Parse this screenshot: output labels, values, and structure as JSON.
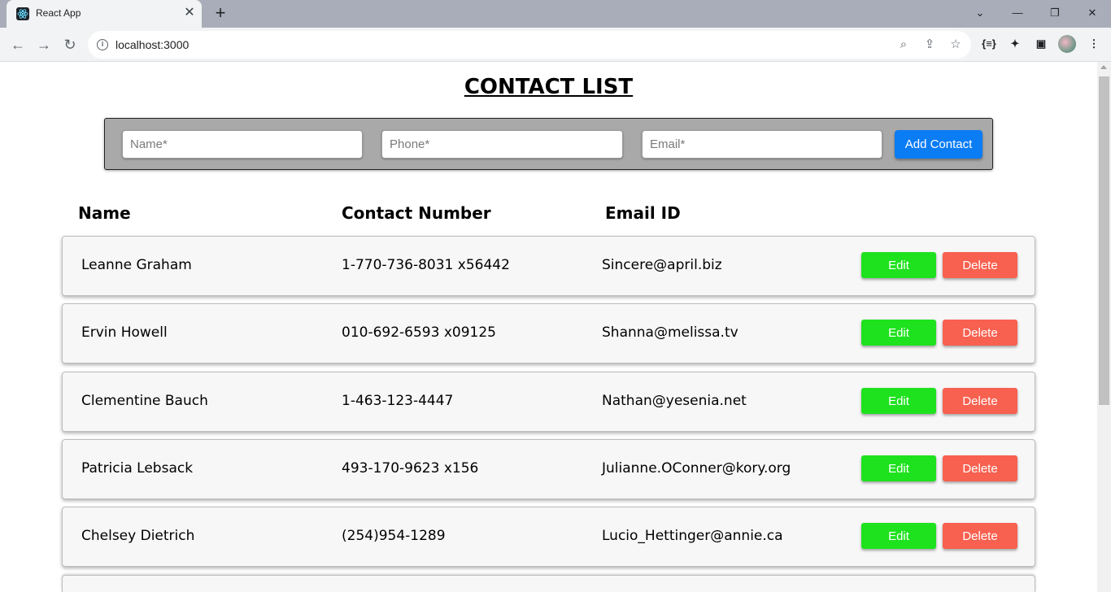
{
  "browser": {
    "tab_title": "React App",
    "tab_close": "✕",
    "new_tab": "+",
    "url": "localhost:3000",
    "window_controls": [
      "⌄",
      "—",
      "❐",
      "✕"
    ]
  },
  "page": {
    "title": "CONTACT LIST"
  },
  "form": {
    "name_placeholder": "Name*",
    "phone_placeholder": "Phone*",
    "email_placeholder": "Email*",
    "add_label": "Add Contact"
  },
  "columns": {
    "name": "Name",
    "phone": "Contact Number",
    "email": "Email ID"
  },
  "contacts": [
    {
      "name": "Leanne Graham",
      "phone": "1-770-736-8031 x56442",
      "email": "Sincere@april.biz"
    },
    {
      "name": "Ervin Howell",
      "phone": "010-692-6593 x09125",
      "email": "Shanna@melissa.tv"
    },
    {
      "name": "Clementine Bauch",
      "phone": "1-463-123-4447",
      "email": "Nathan@yesenia.net"
    },
    {
      "name": "Patricia Lebsack",
      "phone": "493-170-9623 x156",
      "email": "Julianne.OConner@kory.org"
    },
    {
      "name": "Chelsey Dietrich",
      "phone": "(254)954-1289",
      "email": "Lucio_Hettinger@annie.ca"
    }
  ],
  "row_actions": {
    "edit_label": "Edit",
    "delete_label": "Delete"
  },
  "colors": {
    "add_button": "#0a7cf4",
    "edit_button": "#1ee21e",
    "delete_button": "#f8604f",
    "form_background": "#a9a9a9"
  }
}
